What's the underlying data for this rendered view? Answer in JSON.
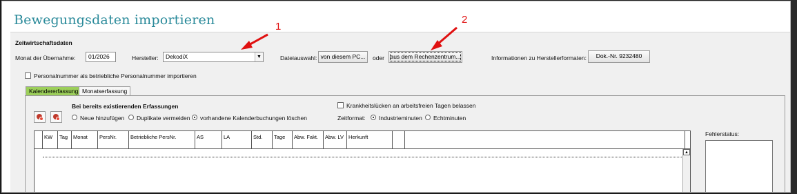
{
  "window": {
    "title": "Bewegungsdaten importieren"
  },
  "section": {
    "title": "Zeitwirtschaftsdaten"
  },
  "form": {
    "monat_label": "Monat der Übernahme:",
    "monat_value": "01/2026",
    "hersteller_label": "Hersteller:",
    "hersteller_value": "DekodiX",
    "dateiauswahl_label": "Dateiauswahl:",
    "btn_pc": "von diesem PC...",
    "oder_label": "oder",
    "btn_rechenzentrum": "aus dem Rechenzentrum...",
    "info_label": "Informationen zu Herstellerformaten:",
    "btn_dok": "Dok.-Nr. 9232480",
    "personalnummer_checkbox": "Personalnummer als betriebliche Personalnummer importieren"
  },
  "tabs": [
    {
      "label": "Kalendererfassung",
      "active": true
    },
    {
      "label": "Monatserfassung",
      "active": false
    }
  ],
  "options": {
    "existing_heading": "Bei bereits existierenden Erfassungen",
    "radio_neue": "Neue hinzufügen",
    "radio_duplikate": "Duplikate vermeiden",
    "radio_vorhandene": "vorhandene Kalenderbuchungen löschen",
    "krankheit_checkbox": "Krankheitslücken an arbeitsfreien Tagen belassen",
    "zeitformat_label": "Zeitformat:",
    "radio_industrie": "Industrieminuten",
    "radio_echt": "Echtminuten"
  },
  "grid": {
    "columns": [
      "",
      "KW",
      "Tag",
      "Monat",
      "PersNr.",
      "Betriebliche PersNr.",
      "AS",
      "LA",
      "Std.",
      "Tage",
      "Abw. Fakt.",
      "Abw. LV",
      "Herkunft",
      "",
      ""
    ]
  },
  "status": {
    "label": "Fehlerstatus:"
  },
  "annotations": {
    "arrow1": "1",
    "arrow2": "2"
  },
  "colors": {
    "title": "#2a8a9a",
    "active_tab": "#9ccf5a",
    "arrow": "#e01010"
  }
}
